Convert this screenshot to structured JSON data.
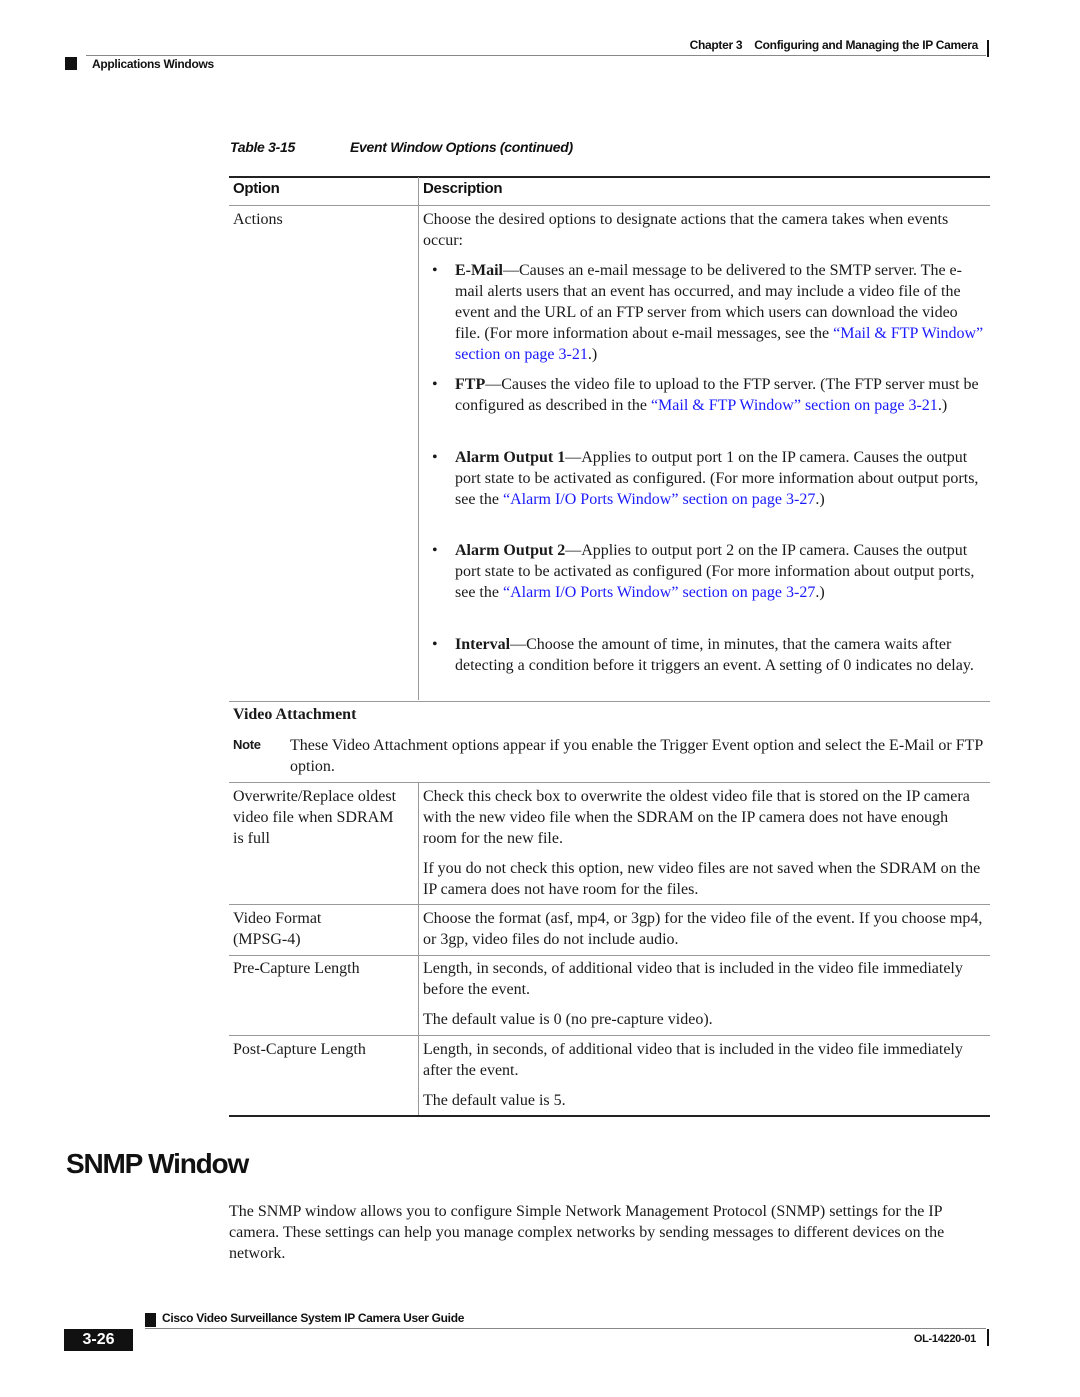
{
  "header": {
    "chapter_label": "Chapter 3",
    "chapter_title": "Configuring and Managing the IP Camera",
    "section": "Applications Windows"
  },
  "table": {
    "caption_number": "Table 3-15",
    "caption_title": "Event Window Options (continued)",
    "columns": [
      "Option",
      "Description"
    ],
    "actions": {
      "option": "Actions",
      "intro": "Choose the desired options to designate actions that the camera takes when events occur:",
      "bullets": [
        {
          "term": "E-Mail",
          "text": "—Causes an e-mail message to be delivered to the SMTP server. The e-mail alerts users that an event has occurred, and may include a video file of the event and the URL of an FTP server from which users can download the video file. (For more information about e-mail messages, see the ",
          "link": "“Mail & FTP Window” section on page 3-21",
          "after": ".)"
        },
        {
          "term": "FTP",
          "text": "—Causes the video file to upload to the FTP server. (The FTP server must be configured as described in the ",
          "link": "“Mail & FTP Window” section on page 3-21",
          "after": ".)"
        },
        {
          "term": "Alarm Output 1",
          "text": "—Applies to output port 1 on the IP camera. Causes the output port state to be activated as configured. (For more information about output ports, see the ",
          "link": "“Alarm I/O Ports Window” section on page 3-27",
          "after": ".)"
        },
        {
          "term": "Alarm Output 2",
          "text": "—Applies to output port 2 on the IP camera. Causes the output port state to be activated as configured (For more information about output ports, see the ",
          "link": "“Alarm I/O Ports Window” section on page 3-27",
          "after": ".)"
        },
        {
          "term": "Interval",
          "text": "—Choose the amount of time, in minutes, that the camera waits after detecting a condition before it triggers an event. A setting of 0 indicates no delay.",
          "link": "",
          "after": ""
        }
      ]
    },
    "video_attachment": {
      "heading": "Video Attachment",
      "note_label": "Note",
      "note_text": "These Video Attachment options appear if you enable the Trigger Event option and select the E-Mail or FTP option."
    },
    "rows": [
      {
        "option": "Overwrite/Replace oldest video file when SDRAM is full",
        "paragraphs": [
          "Check this check box to overwrite the oldest video file that is stored on the IP camera with the new video file when the SDRAM on the IP camera does not have enough room for the new file.",
          "If you do not check this option, new video files are not saved when the SDRAM on the IP camera does not have room for the files."
        ]
      },
      {
        "option": "Video Format (MPSG-4)",
        "paragraphs": [
          "Choose the format (asf, mp4, or 3gp) for the video file of the event. If you choose mp4, or 3gp, video files do not include audio."
        ]
      },
      {
        "option": "Pre-Capture Length",
        "paragraphs": [
          "Length, in seconds, of additional video that is included in the video file immediately before the event.",
          "The default value is 0 (no pre-capture video)."
        ]
      },
      {
        "option": "Post-Capture Length",
        "paragraphs": [
          "Length, in seconds, of additional video that is included in the video file immediately after the event.",
          "The default value is 5."
        ]
      }
    ]
  },
  "snmp": {
    "heading": "SNMP Window",
    "body": "The SNMP window allows you to configure Simple Network Management Protocol (SNMP) settings for the IP camera. These settings can help you manage complex networks by sending messages to different devices on the network."
  },
  "footer": {
    "guide_title": "Cisco Video Surveillance System IP Camera User Guide",
    "page_number": "3-26",
    "doc_number": "OL-14220-01"
  },
  "colors": {
    "link": "#1a1aff",
    "text": "#1a1a1a",
    "rule": "#999999"
  }
}
